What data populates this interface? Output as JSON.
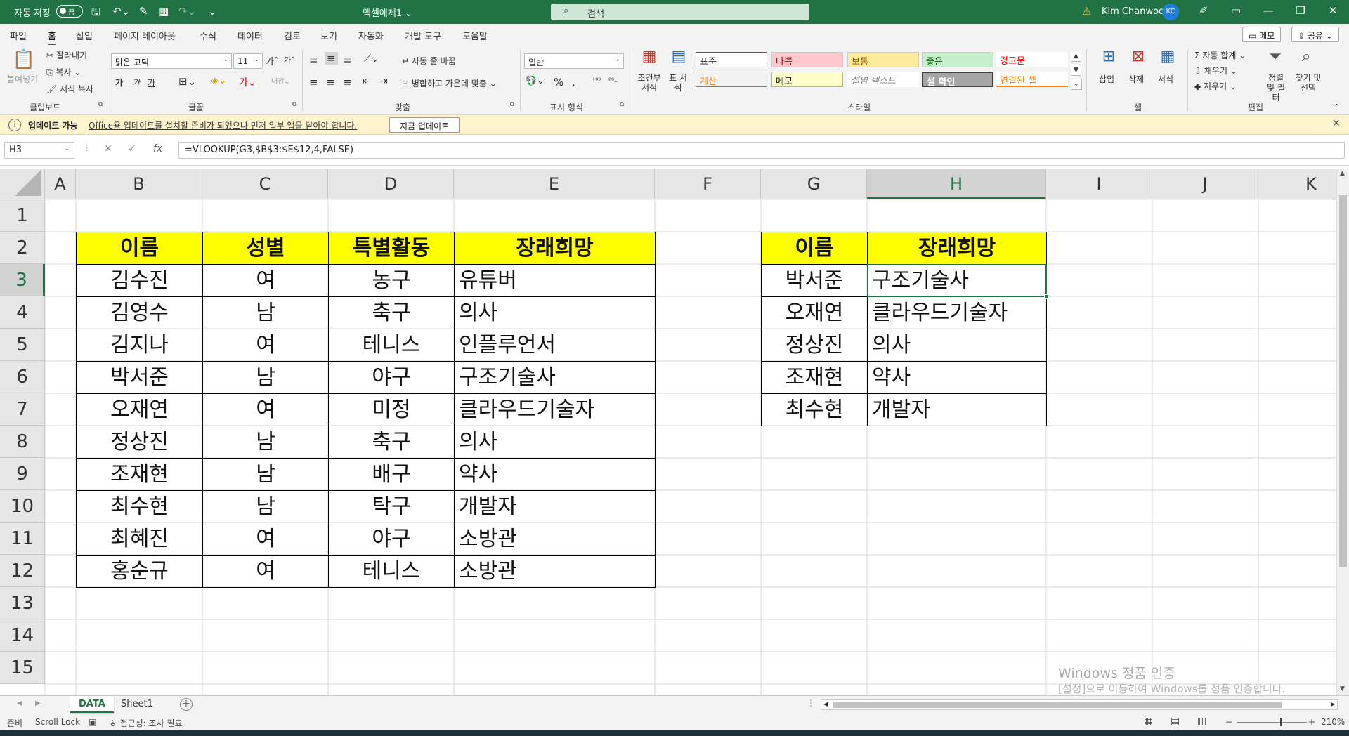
{
  "titlebar": {
    "autosave_label": "자동 저장",
    "autosave_state": "끔",
    "document_title": "엑셀예제1 ⌄",
    "search_placeholder": "검색",
    "user_name": "Kim Chanwoo",
    "user_initials": "KC"
  },
  "menu": {
    "tabs": [
      "파일",
      "홈",
      "삽입",
      "페이지 레이아웃",
      "수식",
      "데이터",
      "검토",
      "보기",
      "자동화",
      "개발 도구",
      "도움말"
    ],
    "active_tab": "홈",
    "memo_label": "메모",
    "share_label": "공유"
  },
  "ribbon": {
    "clipboard": {
      "paste": "붙여넣기",
      "cut": "잘라내기",
      "copy": "복사",
      "format_painter": "서식 복사",
      "group": "클립보드"
    },
    "font": {
      "name": "맑은 고딕",
      "size": "11",
      "bold": "가",
      "italic": "가",
      "underline": "가",
      "group": "글꼴"
    },
    "alignment": {
      "wrap_text": "자동 줄 바꿈",
      "merge_center": "병합하고 가운데 맞춤",
      "group": "맞춤"
    },
    "number": {
      "format": "일반",
      "group": "표시 형식"
    },
    "styles": {
      "conditional": "조건부 서식",
      "table": "표 서식",
      "cells": [
        "표준",
        "나쁨",
        "보통",
        "좋음",
        "경고문",
        "계산",
        "메모",
        "설명 텍스트",
        "셀 확인",
        "연결된 셀"
      ],
      "group": "스타일"
    },
    "cells_group": {
      "insert": "삽입",
      "delete": "삭제",
      "format": "서식",
      "group": "셀"
    },
    "editing": {
      "autosum": "자동 합계",
      "fill": "채우기",
      "clear": "지우기",
      "sort_filter": "정렬 및 필터",
      "find_select": "찾기 및 선택",
      "group": "편집"
    }
  },
  "update_bar": {
    "title": "업데이트 가능",
    "message": "Office용 업데이트를 설치할 준비가 되었으나 먼저 일부 앱을 닫아야 합니다.",
    "button": "지금 업데이트"
  },
  "formula_bar": {
    "name_box": "H3",
    "formula": "=VLOOKUP(G3,$B$3:$E$12,4,FALSE)"
  },
  "columns": [
    "A",
    "B",
    "C",
    "D",
    "E",
    "F",
    "G",
    "H",
    "I",
    "J",
    "K"
  ],
  "selected_column": "H",
  "rows": [
    "1",
    "2",
    "3",
    "4",
    "5",
    "6",
    "7",
    "8",
    "9",
    "10",
    "11",
    "12",
    "13",
    "14",
    "15"
  ],
  "selected_row": "3",
  "table1": {
    "headers": [
      "이름",
      "성별",
      "특별활동",
      "장래희망"
    ],
    "rows": [
      [
        "김수진",
        "여",
        "농구",
        "유튜버"
      ],
      [
        "김영수",
        "남",
        "축구",
        "의사"
      ],
      [
        "김지나",
        "여",
        "테니스",
        "인플루언서"
      ],
      [
        "박서준",
        "남",
        "야구",
        "구조기술사"
      ],
      [
        "오재연",
        "여",
        "미정",
        "클라우드기술자"
      ],
      [
        "정상진",
        "남",
        "축구",
        "의사"
      ],
      [
        "조재현",
        "남",
        "배구",
        "약사"
      ],
      [
        "최수현",
        "남",
        "탁구",
        "개발자"
      ],
      [
        "최혜진",
        "여",
        "야구",
        "소방관"
      ],
      [
        "홍순규",
        "여",
        "테니스",
        "소방관"
      ]
    ]
  },
  "table2": {
    "headers": [
      "이름",
      "장래희망"
    ],
    "rows": [
      [
        "박서준",
        "구조기술사"
      ],
      [
        "오재연",
        "클라우드기술자"
      ],
      [
        "정상진",
        "의사"
      ],
      [
        "조재현",
        "약사"
      ],
      [
        "최수현",
        "개발자"
      ]
    ]
  },
  "watermark": {
    "line1": "Windows 정품 인증",
    "line2": "[설정]으로 이동하여 Windows를 정품 인증합니다."
  },
  "sheets": {
    "tabs": [
      "DATA",
      "Sheet1"
    ],
    "active": "DATA"
  },
  "status": {
    "ready": "준비",
    "scroll_lock": "Scroll Lock",
    "accessibility": "접근성: 조사 필요",
    "zoom": "210%"
  },
  "colors": {
    "excel_green": "#217346",
    "header_fill": "#ffff00",
    "update_bar": "#fff4ce"
  }
}
